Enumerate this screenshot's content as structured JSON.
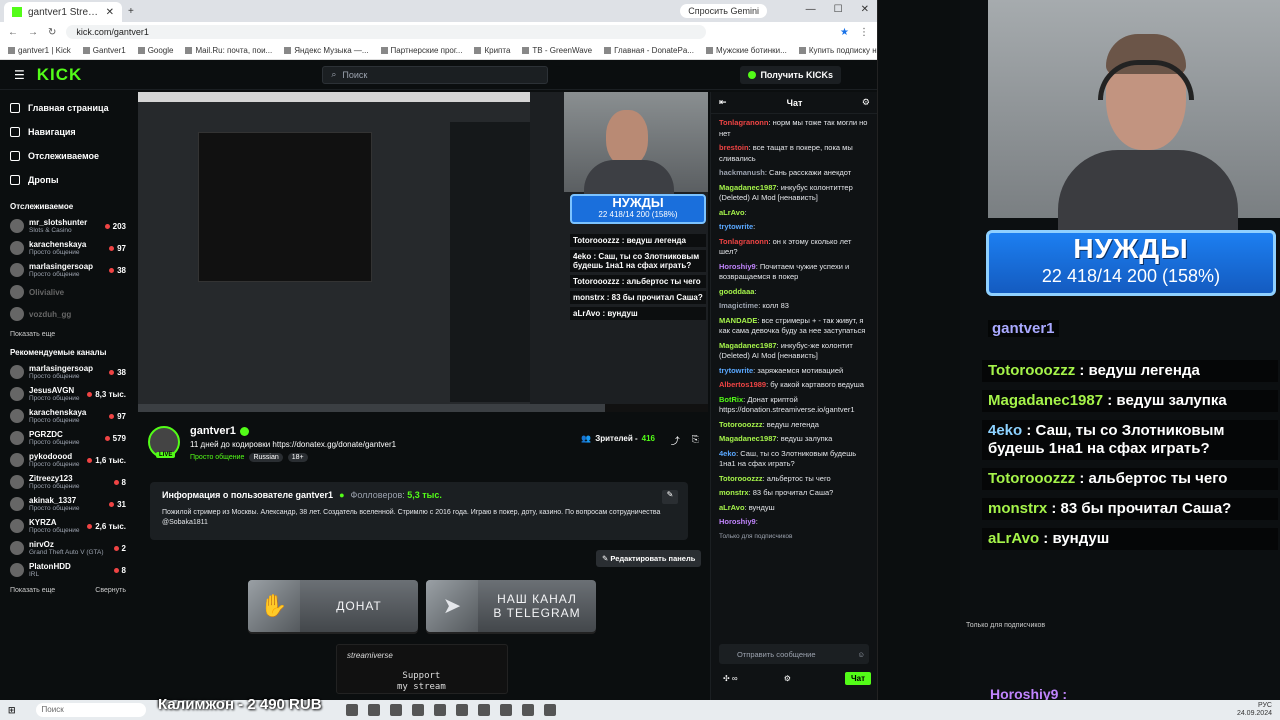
{
  "browser": {
    "tab_title": "gantver1 Stream - Watch Live ...",
    "gemini": "Спросить Gemini",
    "url": "kick.com/gantver1",
    "bookmarks": [
      "gantver1 | Kick",
      "Gantver1",
      "Google",
      "Mail.Ru: почта, пои...",
      "Яндекс Музыка —...",
      "Партнерские прог...",
      "Крипта",
      "ТВ - GreenWave",
      "Главная - DonatePa...",
      "Мужские ботинки...",
      "Купить подписку на..."
    ]
  },
  "kick": {
    "logo": "KICK",
    "search_placeholder": "Поиск",
    "get_kicks": "Получить KICKs"
  },
  "sidebar": {
    "nav": [
      {
        "label": "Главная страница"
      },
      {
        "label": "Навигация"
      },
      {
        "label": "Отслеживаемое"
      },
      {
        "label": "Дропы"
      }
    ],
    "following_title": "Отслеживаемое",
    "following": [
      {
        "name": "mr_slotshunter",
        "cat": "Slots & Casino",
        "viewers": "203"
      },
      {
        "name": "karachenskaya",
        "cat": "Просто общение",
        "viewers": "97"
      },
      {
        "name": "marlasingersoap",
        "cat": "Просто общение",
        "viewers": "38"
      },
      {
        "name": "Olivialive",
        "cat": "",
        "viewers": ""
      },
      {
        "name": "vozduh_gg",
        "cat": "",
        "viewers": ""
      }
    ],
    "show_more": "Показать еще",
    "recommended_title": "Рекомендуемые каналы",
    "recommended": [
      {
        "name": "marlasingersoap",
        "cat": "Просто общение",
        "viewers": "38"
      },
      {
        "name": "JesusAVGN",
        "cat": "Просто общение",
        "viewers": "8,3 тыс."
      },
      {
        "name": "karachenskaya",
        "cat": "Просто общение",
        "viewers": "97"
      },
      {
        "name": "PGRZDC",
        "cat": "Просто общение",
        "viewers": "579"
      },
      {
        "name": "pykodoood",
        "cat": "Просто общение",
        "viewers": "1,6 тыс."
      },
      {
        "name": "Zitreezy123",
        "cat": "Просто общение",
        "viewers": "8"
      },
      {
        "name": "akinak_1337",
        "cat": "Просто общение",
        "viewers": "31"
      },
      {
        "name": "KYRZA",
        "cat": "Просто общение",
        "viewers": "2,6 тыс."
      },
      {
        "name": "nirvOz",
        "cat": "Grand Theft Auto V (GTA)",
        "viewers": "2"
      },
      {
        "name": "PlatonHDD",
        "cat": "IRL",
        "viewers": "8"
      }
    ],
    "show_more2": "Показать еще",
    "collapse": "Свернуть"
  },
  "player": {
    "banner_title": "НУЖДЫ",
    "banner_sub": "22 418/14 200 (158%)",
    "overlay_chat": [
      "Totorooozzz : ведуш легенда",
      "4eko : Саш, ты со Злотниковым будешь 1на1 на сфах играть?",
      "Totorooozzz : альбертос ты чего",
      "monstrx : 83 бы прочитал Саша?",
      "aLrAvo : вундуш"
    ],
    "progress": 0.82
  },
  "stream": {
    "name": "gantver1",
    "title": "11 дней до кодировки https://donatex.gg/donate/gantver1",
    "category": "Просто общение",
    "lang": "Russian",
    "age": "18+",
    "viewers_label": "Зрителей -",
    "viewers": "416",
    "live": "LIVE"
  },
  "about": {
    "heading": "Информация о пользователе gantver1",
    "followers_label": "Фолловеров:",
    "followers": "5,3 тыс.",
    "text": "Пожилой стример из Москвы. Александр, 38 лет. Создатель вселенной. Стримлю с 2016 года. Играю в покер, доту, казино. По вопросам сотрудничества @Sobaka1811",
    "edit_panels": "Редактировать панель"
  },
  "panels": {
    "donate": "ДОНАТ",
    "telegram": "НАШ КАНАЛ\nВ TELEGRAM",
    "sv_logo": "streamiverse",
    "sv_text": "Support\nmy stream"
  },
  "chat": {
    "title": "Чат",
    "messages": [
      {
        "u": "Tonlagranonn",
        "c": "#ef4444",
        "t": "норм мы тоже так могли но нет"
      },
      {
        "u": "brestoin",
        "c": "#ef4444",
        "t": "все тащат в покере, пока мы сливались"
      },
      {
        "u": "hackmanush",
        "c": "#9ca3af",
        "t": "Сань расскажи анекдот"
      },
      {
        "u": "Magadanec1987",
        "c": "#a5f34a",
        "t": "инкубус колонтиттер (Deleted) AI Mod [ненависть]"
      },
      {
        "u": "aLrAvo",
        "c": "#a5f34a",
        "t": ""
      },
      {
        "u": "trytowrite",
        "c": "#5aa8ff",
        "t": ""
      },
      {
        "u": "Tonlagranonn",
        "c": "#ef4444",
        "t": "он к этому сколько лет шел?"
      },
      {
        "u": "Horoshiy9",
        "c": "#c084fc",
        "t": "Почитаем чужие успехи и возвращаемся в покер"
      },
      {
        "u": "gooddaaa",
        "c": "#a5f34a",
        "t": ""
      },
      {
        "u": "Imagictime",
        "c": "#9ca3af",
        "t": "колл 83"
      },
      {
        "u": "MANDADE",
        "c": "#a5f34a",
        "t": "все стримеры + - так живут, я как сама девочка буду за нее заступаться"
      },
      {
        "u": "Magadanec1987",
        "c": "#a5f34a",
        "t": "инкубус-же колонтит (Deleted) AI Mod [ненависть]"
      },
      {
        "u": "trytowrite",
        "c": "#5aa8ff",
        "t": "заряжаемся мотивацией"
      },
      {
        "u": "Albertos1989",
        "c": "#ef4444",
        "t": "бу какой картавого ведуша"
      },
      {
        "u": "BotRix",
        "c": "#53fc18",
        "t": "Донат криптой https://donation.streamiverse.io/gantver1"
      },
      {
        "u": "Totorooozzz",
        "c": "#a5f34a",
        "t": "ведуш легенда"
      },
      {
        "u": "Magadanec1987",
        "c": "#a5f34a",
        "t": "ведуш залупка"
      },
      {
        "u": "4eko",
        "c": "#5aa8ff",
        "t": "Саш, ты со Злотниковым будешь 1на1 на сфах играть?"
      },
      {
        "u": "Totorooozzz",
        "c": "#a5f34a",
        "t": "альбертос ты чего"
      },
      {
        "u": "monstrx",
        "c": "#a5f34a",
        "t": "83 бы прочитал Саша?"
      },
      {
        "u": "aLrAvo",
        "c": "#a5f34a",
        "t": "вундуш"
      },
      {
        "u": "Horoshiy9",
        "c": "#c084fc",
        "t": ""
      }
    ],
    "subs_only": "Только для подписчиков",
    "input_placeholder": "Отправить сообщение",
    "send": "Чат"
  },
  "right_overlay": {
    "banner_title": "НУЖДЫ",
    "banner_sub": "22 418/14 200 (158%)",
    "tag": "gantver1",
    "messages": [
      {
        "u": "Totorooozzz",
        "t": "ведуш легенда",
        "cls": ""
      },
      {
        "u": "Magadanec1987",
        "t": "ведуш залупка",
        "cls": ""
      },
      {
        "u": "4eko",
        "t": "Саш, ты со Злотниковым будешь 1на1 на сфах играть?",
        "cls": "b"
      },
      {
        "u": "Totorooozzz",
        "t": "альбертос ты чего",
        "cls": ""
      },
      {
        "u": "monstrx",
        "t": "83 бы прочитал Саша?",
        "cls": ""
      },
      {
        "u": "aLrAvo",
        "t": "вундуш",
        "cls": ""
      }
    ],
    "last_user": "Horoshiy9 :",
    "subs_only": "Только для подписчиков"
  },
  "taskbar": {
    "search": "Поиск",
    "donation": "Калимжон - 2 490 RUB",
    "lang": "РУС",
    "date": "24.09.2024"
  }
}
